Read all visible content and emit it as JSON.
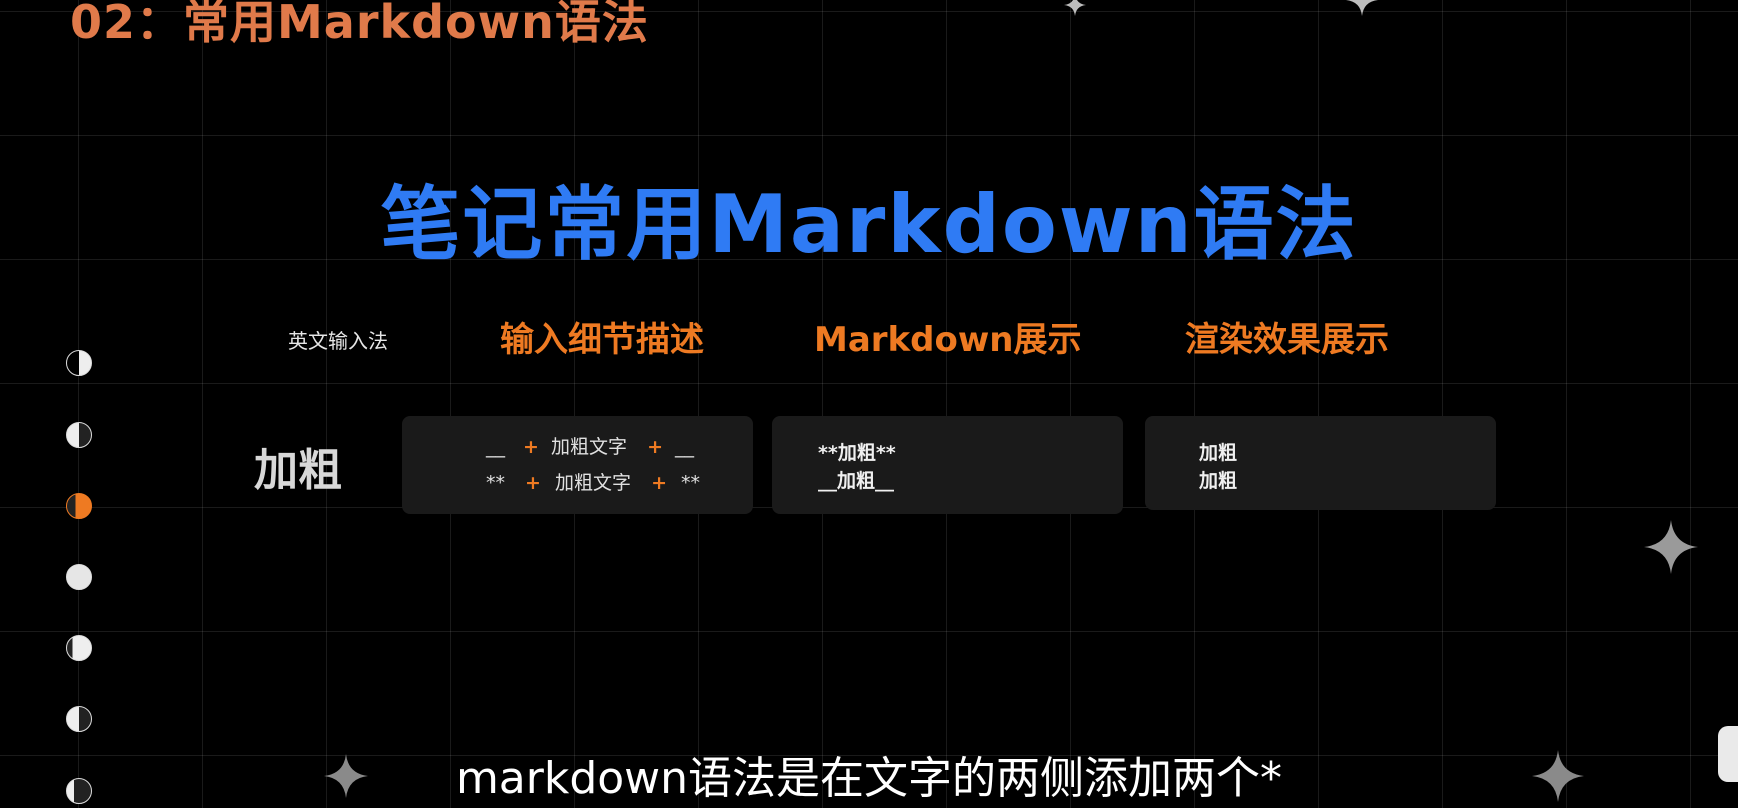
{
  "section_title": "02：常用Markdown语法",
  "main_title": "笔记常用Markdown语法",
  "ime_label": "英文输入法",
  "columns": [
    "输入细节描述",
    "Markdown展示",
    "渲染效果展示"
  ],
  "row": {
    "label": "加粗",
    "input_detail": {
      "line1": {
        "left": "__",
        "text": "加粗文字",
        "right": "__"
      },
      "line2": {
        "left": "**",
        "text": "加粗文字",
        "right": "**"
      },
      "plus": "+"
    },
    "markdown": [
      "**加粗**",
      "__加粗__"
    ],
    "rendered": [
      "加粗",
      "加粗"
    ]
  },
  "subtitle": "markdown语法是在文字的两侧添加两个*",
  "colors": {
    "section_title": "#e07a4a",
    "main_title": "#2f7bf4",
    "column_head": "#ee7a22",
    "active_dot": "#ee7a22",
    "card_bg": "#1a1a1a"
  },
  "nav_dots": [
    {
      "phase": "crescent-right",
      "active": false
    },
    {
      "phase": "half-left",
      "active": false
    },
    {
      "phase": "half-right",
      "active": true
    },
    {
      "phase": "full",
      "active": false
    },
    {
      "phase": "gibbous",
      "active": false
    },
    {
      "phase": "half-left",
      "active": false
    },
    {
      "phase": "crescent-left",
      "active": false
    }
  ]
}
